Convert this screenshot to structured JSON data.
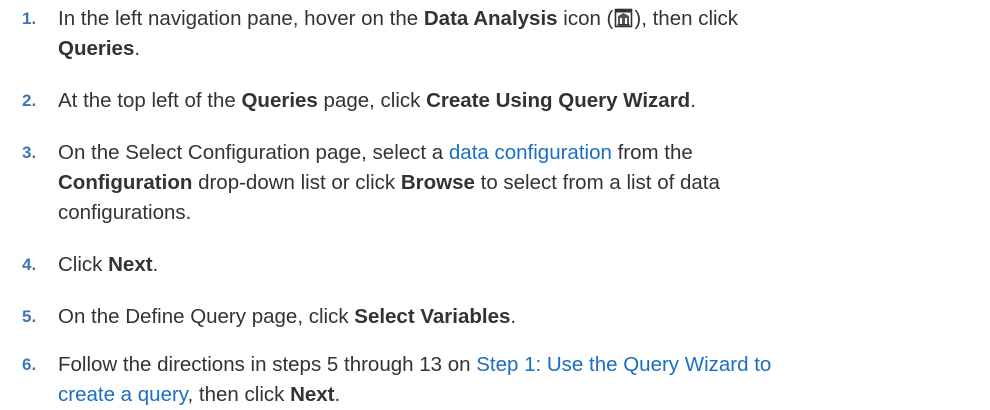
{
  "steps": [
    {
      "number": "1.",
      "parts": {
        "a": "In the left navigation pane, hover on the ",
        "b1": "Data Analysis",
        "c": " icon (",
        "icon": "data-analysis-icon",
        "d": "), then click",
        "b2": "Queries",
        "e": "."
      }
    },
    {
      "number": "2.",
      "parts": {
        "a": "At the top left of the ",
        "b1": "Queries",
        "c": " page, click ",
        "b2": "Create Using Query Wizard",
        "d": "."
      }
    },
    {
      "number": "3.",
      "parts": {
        "a": "On the Select Configuration page, select a ",
        "link": "data configuration",
        "c": " from the",
        "b1": "Configuration",
        "d": " drop-down list or click ",
        "b2": "Browse",
        "e": " to select from a list of data",
        "f": "configurations."
      }
    },
    {
      "number": "4.",
      "parts": {
        "a": "Click ",
        "b1": "Next",
        "c": "."
      }
    },
    {
      "number": "5.",
      "parts": {
        "a": "On the Define Query page, click ",
        "b1": "Select Variables",
        "c": "."
      }
    },
    {
      "number": "6.",
      "parts": {
        "a": "Follow the directions in steps 5 through 13 on ",
        "link1": "Step 1: Use the Query Wizard to",
        "link2": "create a query",
        "c": ", then click ",
        "b1": "Next",
        "d": "."
      }
    }
  ],
  "colors": {
    "number": "#3c78b4",
    "link": "#1a6fc0",
    "text": "#333333"
  }
}
